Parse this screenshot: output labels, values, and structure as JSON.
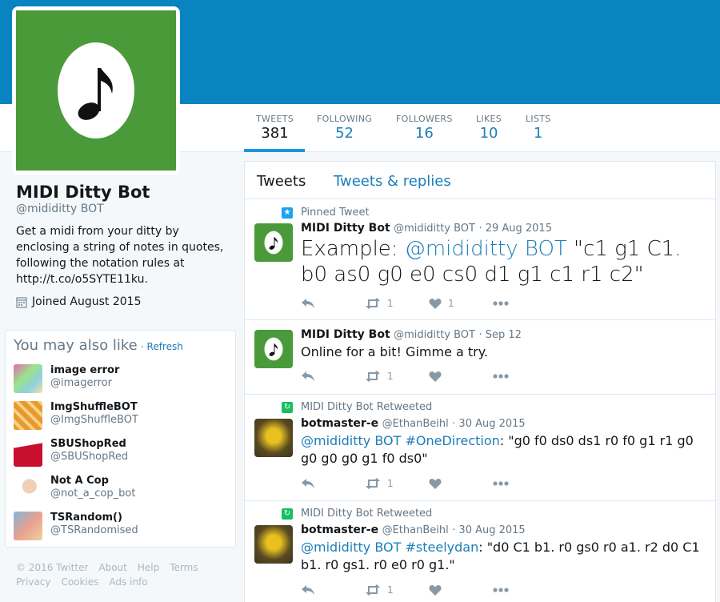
{
  "profile": {
    "name": "MIDI Ditty Bot",
    "handle": "@mididitty BOT",
    "bio": "Get a midi from your ditty by enclosing a string of notes in quotes, following the notation rules at http://t.co/o5SYTE11ku.",
    "joined": "Joined August 2015"
  },
  "nav": [
    {
      "label": "TWEETS",
      "value": "381"
    },
    {
      "label": "FOLLOWING",
      "value": "52"
    },
    {
      "label": "FOLLOWERS",
      "value": "16"
    },
    {
      "label": "LIKES",
      "value": "10"
    },
    {
      "label": "LISTS",
      "value": "1"
    }
  ],
  "wtf": {
    "title": "You may also like",
    "dot": "·",
    "refresh": "Refresh",
    "items": [
      {
        "name": "image error",
        "handle": "@imagerror"
      },
      {
        "name": "ImgShuffleBOT",
        "handle": "@ImgShuffleBOT"
      },
      {
        "name": "SBUShopRed",
        "handle": "@SBUShopRed"
      },
      {
        "name": "Not A Cop",
        "handle": "@not_a_cop_bot"
      },
      {
        "name": "TSRandom()",
        "handle": "@TSRandomised"
      }
    ]
  },
  "footer": {
    "links1": [
      "© 2016 Twitter",
      "About",
      "Help",
      "Terms"
    ],
    "links2": [
      "Privacy",
      "Cookies",
      "Ads info"
    ]
  },
  "tabs": {
    "tweets": "Tweets",
    "replies": "Tweets & replies"
  },
  "tweets": [
    {
      "context": "Pinned Tweet",
      "name": "MIDI Ditty Bot",
      "handle": "@mididitty BOT",
      "time": "· 29 Aug 2015",
      "text_pre": "Example: ",
      "text_link": "@mididitty BOT",
      "text_post": " \"c1 g1 C1. b0 as0 g0 e0 cs0 d1 g1 c1 r1 c2\"",
      "retweets": "1",
      "likes": "1"
    },
    {
      "name": "MIDI Ditty Bot",
      "handle": "@mididitty BOT",
      "time": "· Sep 12",
      "text": "Online for a bit! Gimme a try.",
      "retweets": "1",
      "likes": ""
    },
    {
      "context": "MIDI Ditty Bot Retweeted",
      "name": "botmaster-e",
      "handle": "@EthanBeihl",
      "time": "· 30 Aug 2015",
      "text_link1": "@mididitty BOT",
      "text_link2": " #OneDirection",
      "text_post": ": \"g0 f0 ds0 ds1 r0 f0 g1 r1 g0 g0 g0 g0 g1 f0 ds0\"",
      "retweets": "1",
      "likes": ""
    },
    {
      "context": "MIDI Ditty Bot Retweeted",
      "name": "botmaster-e",
      "handle": "@EthanBeihl",
      "time": "· 30 Aug 2015",
      "text_link1": "@mididitty BOT",
      "text_link2": " #steelydan",
      "text_post": ": \"d0 C1 b1. r0 gs0 r0 a1. r2 d0 C1 b1. r0 gs1. r0 e0 r0 g1.\"",
      "retweets": "1",
      "likes": ""
    }
  ],
  "colors": {
    "banner": "#0a84c1",
    "accent": "#1b7eb8",
    "avatar_green": "#4a9a3a"
  }
}
